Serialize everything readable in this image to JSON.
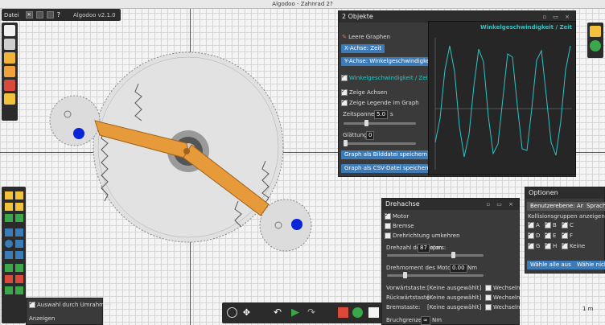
{
  "window": {
    "title": "Algodoo - Zahnrad 2?"
  },
  "topbar": {
    "menu_label": "Datei",
    "version_label": "Algodoo v2.1.0",
    "help_label": "?"
  },
  "graph_panel": {
    "title": "2 Objekte",
    "clear_graphs": "Leere Graphen",
    "xaxis_btn": "X-Achse: Zeit",
    "yaxis_btn": "Y-Achse: Winkelgeschwindigkeit",
    "series_header": "Winkelgeschwindigkeit / Zeit",
    "show_axes": "Zeige Achsen",
    "show_legend": "Zeige Legende im Graph",
    "time_span_label": "Zeitspanne",
    "time_span_value": "5.0",
    "time_span_unit": "s",
    "smooth_label": "Glättung",
    "smooth_value": "0",
    "save_image_btn": "Graph als Bilddatei speichern",
    "save_csv_btn": "Graph als CSV-Datei speichern",
    "graph_title": "Winkelgeschwindigkeit / Zeit",
    "graph_color": "#2ec4c4"
  },
  "axle_panel": {
    "title": "Drehachse",
    "motor": "Motor",
    "brake": "Bremse",
    "reverse": "Drehrichtung umkehren",
    "motor_speed_label": "Drehzahl des Motors:",
    "motor_speed_value": "87",
    "motor_speed_unit": "rpm",
    "motor_torque_label": "Drehmoment des Motors:",
    "motor_torque_value": "0.00",
    "motor_torque_unit": "Nm",
    "forward_key_label": "Vorwärtstaste:",
    "backward_key_label": "Rückwärtstaste:",
    "brake_key_label": "Bremstaste:",
    "key_placeholder": "[Keine ausgewählt]",
    "toggle_label": "Wechseln",
    "break_limit_label": "Bruchgrenze",
    "break_limit_value": "∞",
    "break_limit_unit": "Nm"
  },
  "options_panel": {
    "title": "Optionen",
    "user_level_btn": "Benutzerebene: Anfänger",
    "language_btn": "Sprache",
    "collision_label": "Kollisionsgruppen anzeigen",
    "groups": [
      "A",
      "B",
      "C",
      "D",
      "E",
      "F",
      "G",
      "H",
      "Keine"
    ],
    "select_all_btn": "Wähle alle aus",
    "select_none_btn": "Wähle nichts"
  },
  "selection_panel": {
    "select_by_rect": "Auswahl durch Umrahmen",
    "extra_label": "Anzeigen"
  },
  "scale_label": "1 m",
  "colors": {
    "accent": "#3b7bb8",
    "gear": "#e0e0e0",
    "arm": "#e69a3a",
    "wheel_dot": "#0a24d9"
  }
}
